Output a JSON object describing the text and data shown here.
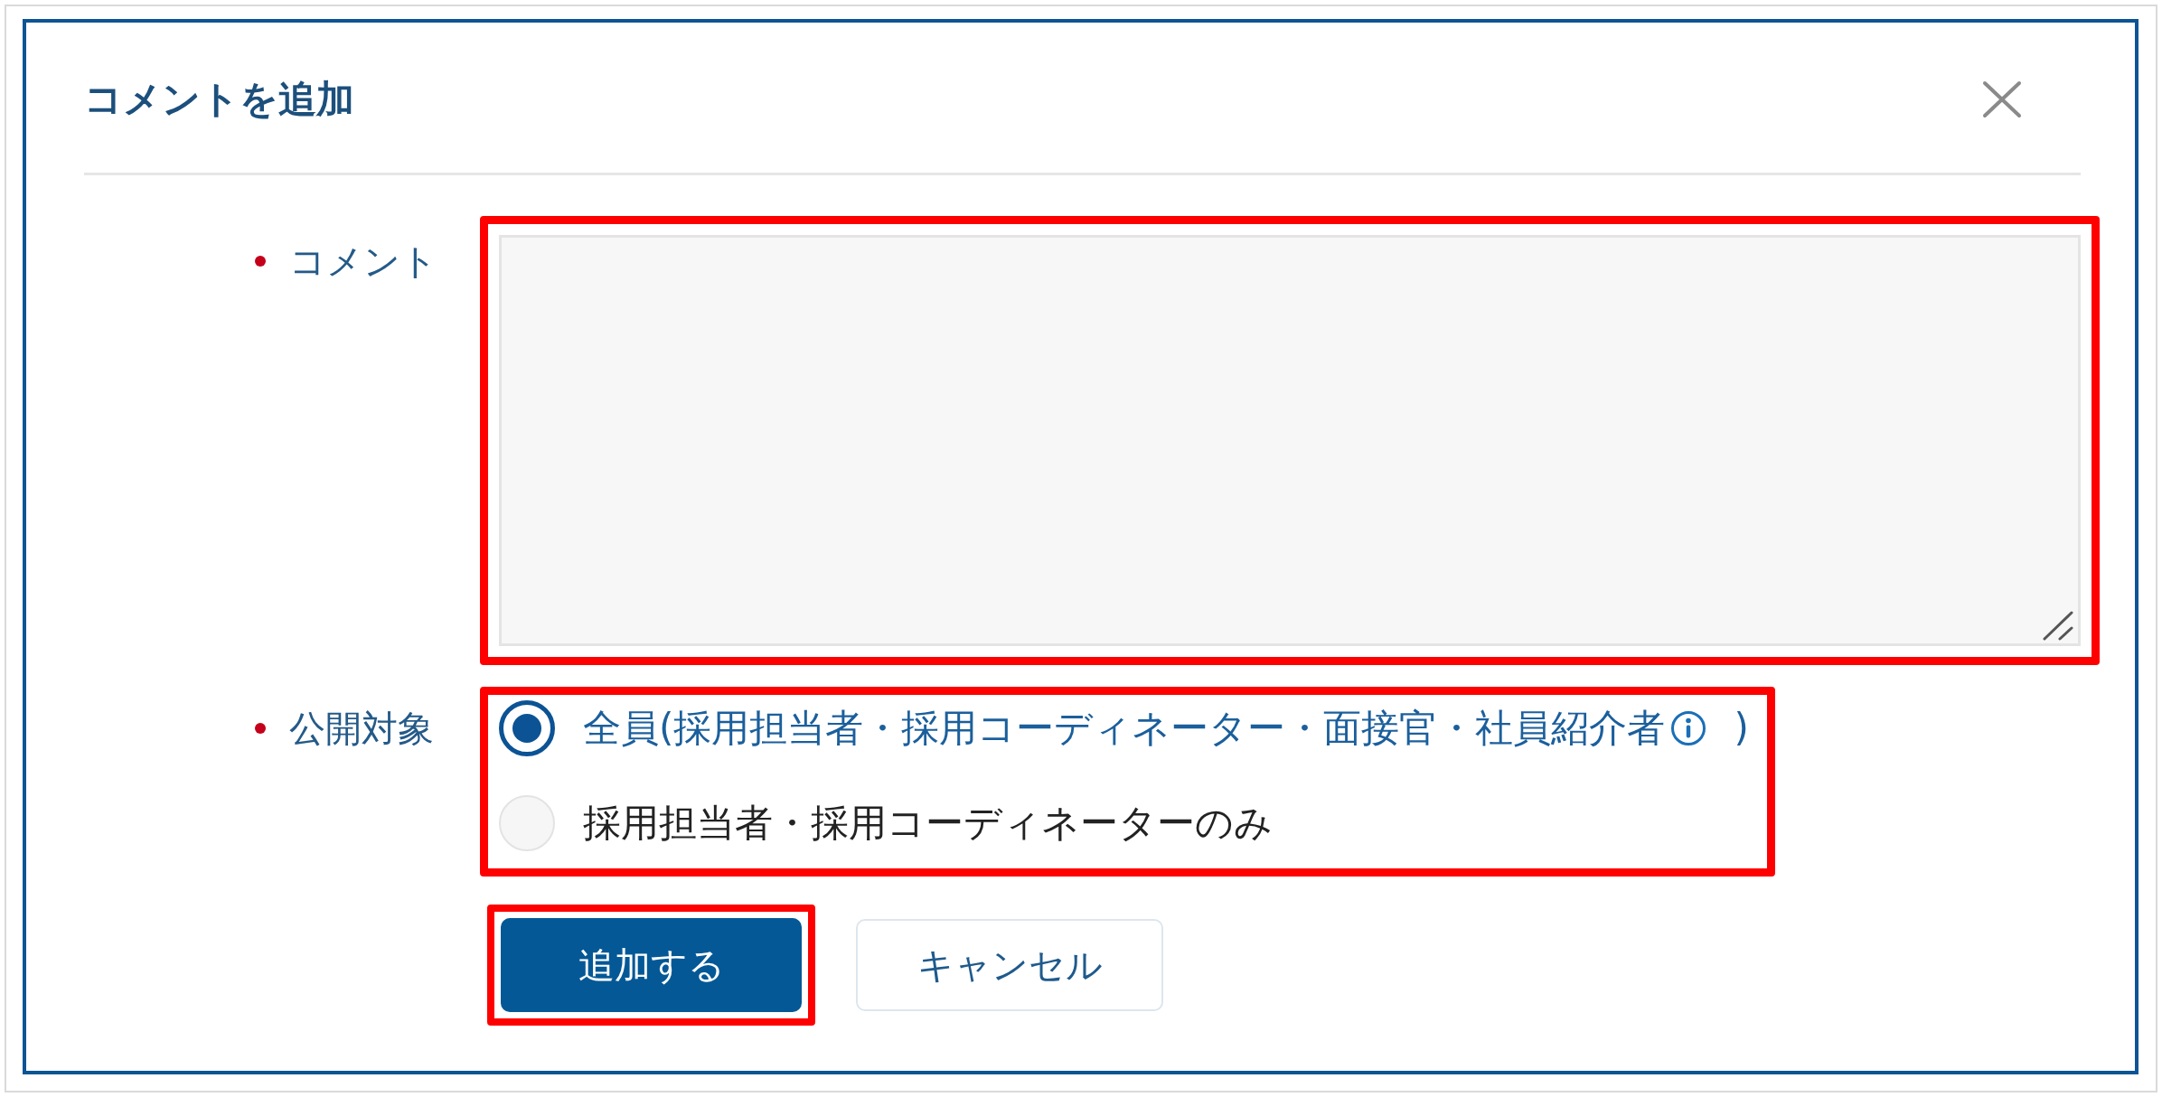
{
  "dialog": {
    "title": "コメントを追加"
  },
  "comment": {
    "label": "コメント",
    "required": true,
    "highlighted": true
  },
  "visibility": {
    "label": "公開対象",
    "required": true,
    "highlighted": true,
    "options": [
      {
        "label": "全員(採用担当者・採用コーディネーター・面接官・社員紹介者",
        "info": true,
        "suffix": ")",
        "selected": true
      },
      {
        "label": "採用担当者・採用コーディネーターのみ",
        "info": false,
        "selected": false
      }
    ]
  },
  "buttons": [
    {
      "label": "追加する",
      "kind": "primary",
      "highlighted": true
    },
    {
      "label": "キャンセル",
      "kind": "secondary",
      "highlighted": false
    }
  ]
}
